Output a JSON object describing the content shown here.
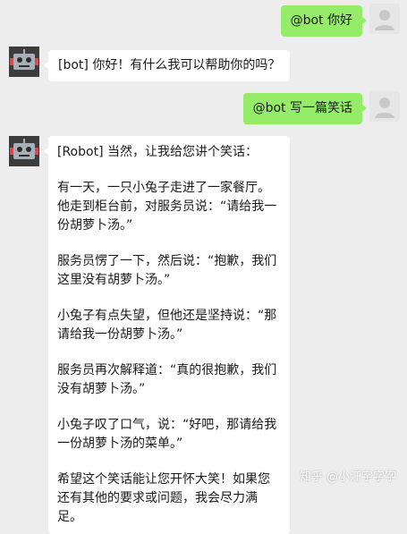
{
  "messages": [
    {
      "from": "user",
      "text": "@bot 你好"
    },
    {
      "from": "bot",
      "text": "[bot] 你好！有什么我可以帮助你的吗？"
    },
    {
      "from": "user",
      "text": "@bot 写一篇笑话"
    },
    {
      "from": "bot",
      "paragraphs": [
        "[Robot] 当然，让我给您讲个笑话：",
        "有一天，一只小兔子走进了一家餐厅。他走到柜台前，对服务员说：“请给我一份胡萝卜汤。”",
        "服务员愣了一下，然后说：“抱歉，我们这里没有胡萝卜汤。”",
        "小兔子有点失望，但他还是坚持说：“那请给我一份胡萝卜汤。”",
        "服务员再次解释道：“真的很抱歉，我们没有胡萝卜汤。”",
        "小兔子叹了口气，说：“好吧，那请给我一份胡萝卜汤的菜单。”",
        "希望这个笑话能让您开怀大笑！如果您还有其他的要求或问题，我会尽力满足。"
      ]
    }
  ],
  "watermark": "知乎 @小汪字字字",
  "icons": {
    "user_avatar": "person-silhouette-icon",
    "bot_avatar": "robot-icon"
  }
}
